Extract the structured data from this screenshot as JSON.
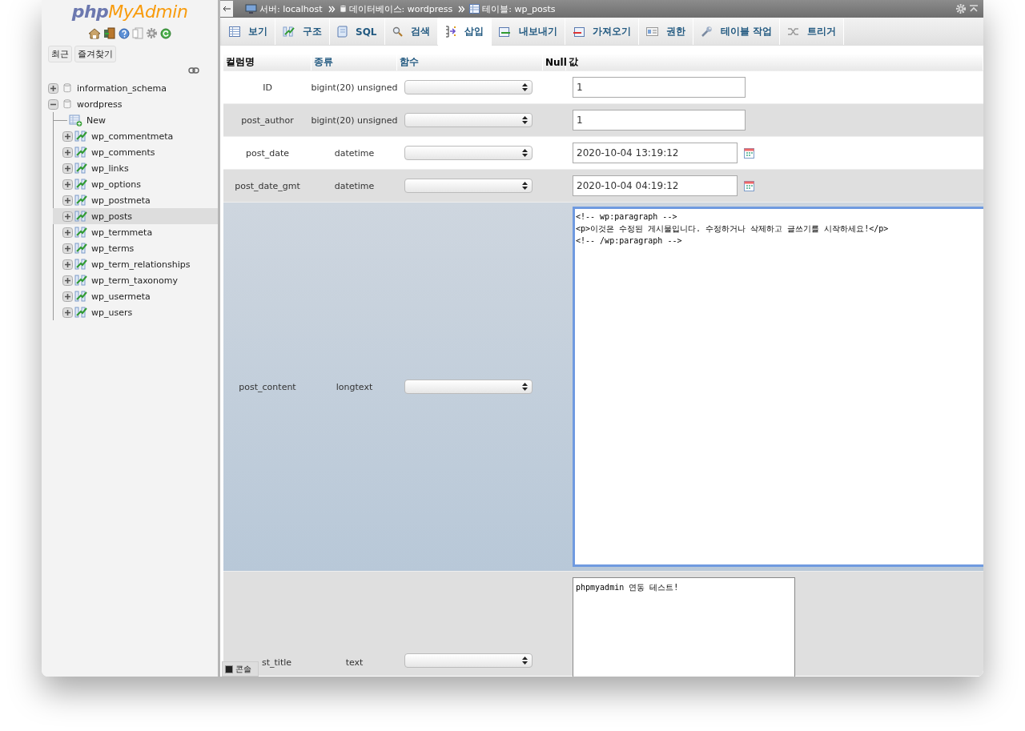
{
  "sidebar": {
    "logo": {
      "prefix": "php",
      "name": "MyAdmin"
    },
    "buttons": [
      "최근",
      "즐겨찾기"
    ],
    "databases": [
      {
        "name": "information_schema",
        "expanded": false
      },
      {
        "name": "wordpress",
        "expanded": true,
        "children": [
          {
            "name": "New",
            "kind": "new",
            "selected": false
          },
          {
            "name": "wp_commentmeta",
            "kind": "table",
            "selected": false
          },
          {
            "name": "wp_comments",
            "kind": "table",
            "selected": false
          },
          {
            "name": "wp_links",
            "kind": "table",
            "selected": false
          },
          {
            "name": "wp_options",
            "kind": "table",
            "selected": false
          },
          {
            "name": "wp_postmeta",
            "kind": "table",
            "selected": false
          },
          {
            "name": "wp_posts",
            "kind": "table",
            "selected": true
          },
          {
            "name": "wp_termmeta",
            "kind": "table",
            "selected": false
          },
          {
            "name": "wp_terms",
            "kind": "table",
            "selected": false
          },
          {
            "name": "wp_term_relationships",
            "kind": "table",
            "selected": false
          },
          {
            "name": "wp_term_taxonomy",
            "kind": "table",
            "selected": false
          },
          {
            "name": "wp_usermeta",
            "kind": "table",
            "selected": false
          },
          {
            "name": "wp_users",
            "kind": "table",
            "selected": false
          }
        ]
      }
    ]
  },
  "breadcrumb": [
    {
      "kind": "server",
      "label": "서버: localhost"
    },
    {
      "kind": "database",
      "label": "데이터베이스: wordpress"
    },
    {
      "kind": "table",
      "label": "테이블: wp_posts"
    }
  ],
  "tabs": [
    {
      "label": "보기",
      "selected": false
    },
    {
      "label": "구조",
      "selected": false
    },
    {
      "label": "SQL",
      "selected": false
    },
    {
      "label": "검색",
      "selected": false
    },
    {
      "label": "삽입",
      "selected": true
    },
    {
      "label": "내보내기",
      "selected": false
    },
    {
      "label": "가져오기",
      "selected": false
    },
    {
      "label": "권한",
      "selected": false
    },
    {
      "label": "테이블 작업",
      "selected": false
    },
    {
      "label": "트리거",
      "selected": false
    }
  ],
  "table": {
    "columns": [
      "컬럼명",
      "종류",
      "함수",
      "Null",
      "값"
    ],
    "rows": [
      {
        "name": "ID",
        "type": "bigint(20) unsigned",
        "kind": "input",
        "value": "1",
        "highlighted": false
      },
      {
        "name": "post_author",
        "type": "bigint(20) unsigned",
        "kind": "input",
        "value": "1",
        "highlighted": false
      },
      {
        "name": "post_date",
        "type": "datetime",
        "kind": "datetime",
        "value": "2020-10-04 13:19:12",
        "highlighted": false
      },
      {
        "name": "post_date_gmt",
        "type": "datetime",
        "kind": "datetime",
        "value": "2020-10-04 04:19:12",
        "highlighted": false
      },
      {
        "name": "post_content",
        "type": "longtext",
        "kind": "editor",
        "value": "<!-- wp:paragraph -->\n<p>이것은 수정된 게시물입니다. 수정하거나 삭제하고 글쓰기를 시작하세요!</p>\n<!-- /wp:paragraph -->",
        "highlighted": true,
        "focused": true
      },
      {
        "name": "st_title",
        "type": "text",
        "kind": "textarea",
        "value": "phpmyadmin 연동 테스트!",
        "highlighted": false,
        "focused": false
      }
    ]
  },
  "console": {
    "label": "콘솔"
  }
}
